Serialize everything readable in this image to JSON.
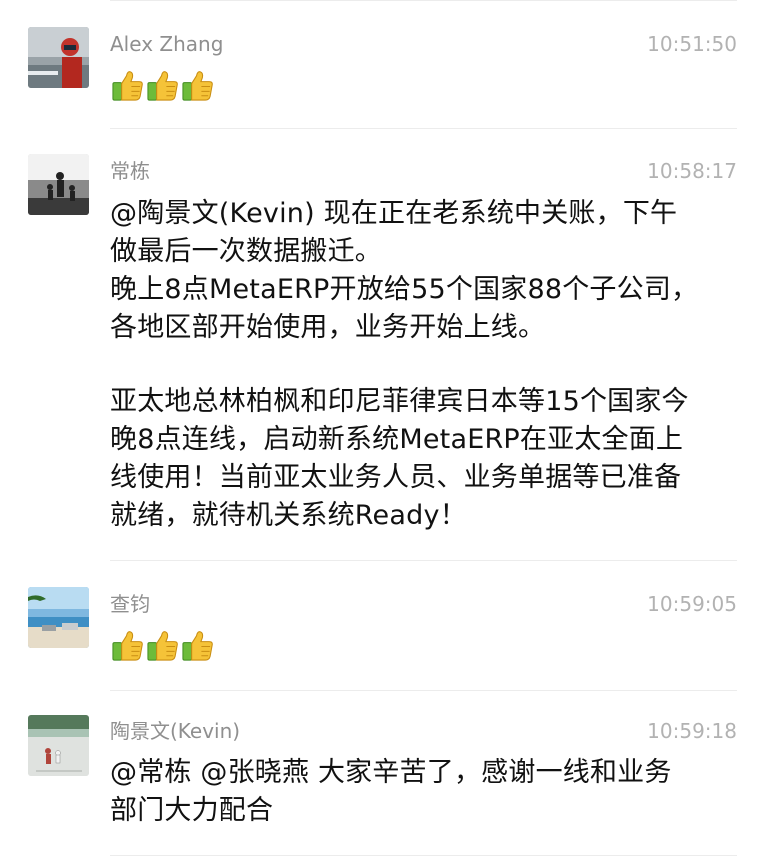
{
  "messages": [
    {
      "sender": "Alex Zhang",
      "time": "10:51:50",
      "reactions": [
        "thumbs-up-icon",
        "thumbs-up-icon",
        "thumbs-up-icon"
      ]
    },
    {
      "sender": "常栋",
      "time": "10:58:17",
      "paragraph1": "@陶景文(Kevin) 现在正在老系统中关账，下午\n做最后一次数据搬迁。\n晚上8点MetaERP开放给55个国家88个子公司，\n各地区部开始使用，业务开始上线。",
      "paragraph2": "亚太地总林柏枫和印尼菲律宾日本等15个国家今\n晚8点连线，启动新系统MetaERP在亚太全面上\n线使用！当前亚太业务人员、业务单据等已准备\n就绪，就待机关系统Ready！"
    },
    {
      "sender": "查钧",
      "time": "10:59:05",
      "reactions": [
        "thumbs-up-icon",
        "thumbs-up-icon",
        "thumbs-up-icon"
      ]
    },
    {
      "sender": "陶景文(Kevin)",
      "time": "10:59:18",
      "text": "@常栋 @张晓燕 大家辛苦了，感谢一线和业务\n部门大力配合"
    }
  ],
  "colors": {
    "name": "#8f8f8f",
    "time": "#b2b2b2",
    "text": "#111111",
    "divider": "#ececec",
    "thumb_yellow": "#f5c338",
    "thumb_green": "#6dbb3a"
  }
}
